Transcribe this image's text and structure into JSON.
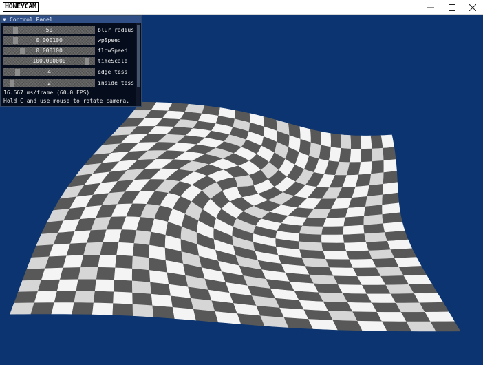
{
  "window": {
    "title": "HONEYCAM",
    "minimize_glyph": "–",
    "maximize_glyph": "☐",
    "close_glyph": "✕",
    "icons": [
      "minimize-icon",
      "maximize-icon",
      "close-icon"
    ]
  },
  "panel": {
    "title": "Control Panel",
    "collapse_glyph": "▼",
    "sliders": [
      {
        "value": "50",
        "label": "blur radius",
        "fraction": 0.1
      },
      {
        "value": "0.000100",
        "label": "wpSpeed",
        "fraction": 0.1
      },
      {
        "value": "0.000100",
        "label": "flowSpeed",
        "fraction": 0.18
      },
      {
        "value": "100.000000",
        "label": "timeScale",
        "fraction": 0.95
      },
      {
        "value": "4",
        "label": "edge tess",
        "fraction": 0.12
      },
      {
        "value": "2",
        "label": "inside tess",
        "fraction": 0.06
      }
    ],
    "fps_text": "16.667 ms/frame (60.0 FPS)",
    "hint_text": "Hold C and use mouse to rotate camera."
  },
  "scene": {
    "background_color": "#0b3470",
    "check_dark": "#585858",
    "check_light": "#f4f4f4",
    "check_light_alt": "#d6d6d6",
    "grid_cells": 20,
    "swirl_strength": 1.6
  }
}
